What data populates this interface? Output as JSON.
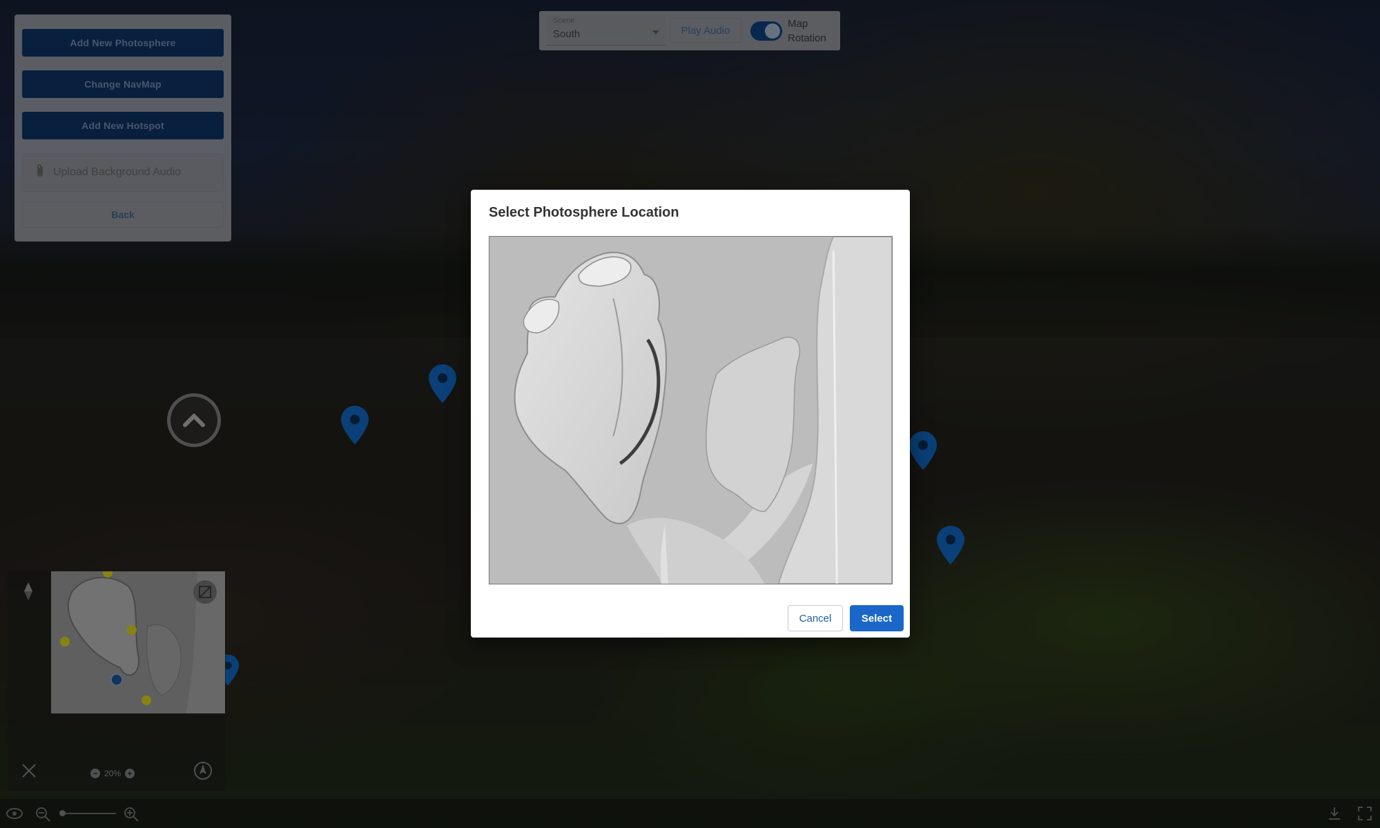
{
  "left_panel": {
    "add_photosphere_label": "Add New Photosphere",
    "change_navmap_label": "Change NavMap",
    "add_hotspot_label": "Add New Hotspot",
    "upload_audio_label": "Upload Background Audio",
    "back_label": "Back"
  },
  "top_bar": {
    "scene_field_label": "Scene",
    "scene_value": "South",
    "play_audio_label": "Play Audio",
    "map_rotation_label_line1": "Map",
    "map_rotation_label_line2": "Rotation",
    "map_rotation_on": true
  },
  "minimap": {
    "zoom_level": "20%"
  },
  "modal": {
    "title": "Select Photosphere Location",
    "cancel_label": "Cancel",
    "select_label": "Select"
  },
  "colors": {
    "primary": "#1a67c9",
    "marker": "#0f5fb0",
    "minimap_dot": "#c9c21a"
  },
  "icons": [
    "paperclip-icon",
    "chevron-up-icon",
    "compass-icon",
    "expand-icon",
    "close-icon",
    "recenter-icon",
    "zoom-out-icon",
    "zoom-in-icon",
    "view-mode-icon",
    "download-icon",
    "fullscreen-icon",
    "map-marker-icon"
  ]
}
